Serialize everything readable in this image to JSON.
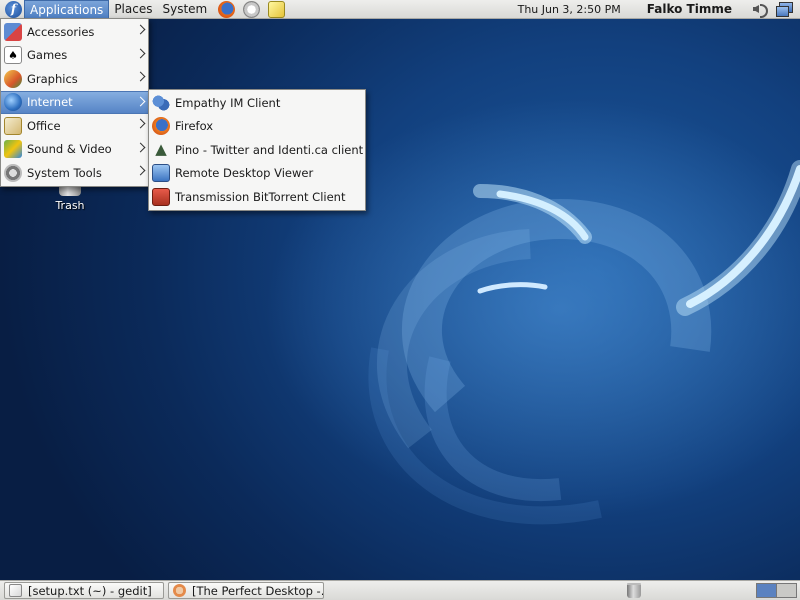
{
  "top_panel": {
    "menus": [
      "Applications",
      "Places",
      "System"
    ],
    "launchers": [
      "firefox-icon",
      "mail-icon",
      "note-icon"
    ],
    "clock": "Thu Jun  3,  2:50 PM",
    "user": "Falko Timme"
  },
  "desktop": {
    "trash_label": "Trash"
  },
  "applications_menu": {
    "items": [
      {
        "label": "Accessories",
        "icon": "accessories-icon"
      },
      {
        "label": "Games",
        "icon": "games-icon"
      },
      {
        "label": "Graphics",
        "icon": "graphics-icon"
      },
      {
        "label": "Internet",
        "icon": "internet-icon",
        "active": true
      },
      {
        "label": "Office",
        "icon": "office-icon"
      },
      {
        "label": "Sound & Video",
        "icon": "sound-video-icon"
      },
      {
        "label": "System Tools",
        "icon": "system-tools-icon"
      }
    ]
  },
  "internet_submenu": {
    "items": [
      {
        "label": "Empathy IM Client",
        "icon": "empathy-icon"
      },
      {
        "label": "Firefox",
        "icon": "firefox-icon"
      },
      {
        "label": "Pino - Twitter and Identi.ca client",
        "icon": "pino-icon"
      },
      {
        "label": "Remote Desktop Viewer",
        "icon": "remote-desktop-icon"
      },
      {
        "label": "Transmission BitTorrent Client",
        "icon": "transmission-icon"
      }
    ]
  },
  "bottom_panel": {
    "tasks": [
      {
        "label": "[setup.txt (~) - gedit]",
        "icon": "gedit-icon"
      },
      {
        "label": "[The Perfect Desktop -...",
        "icon": "firefox-icon"
      }
    ]
  },
  "colors": {
    "panel": "#e4e4e2",
    "selection": "#5684c6",
    "desktop_blue": "#12407e"
  }
}
